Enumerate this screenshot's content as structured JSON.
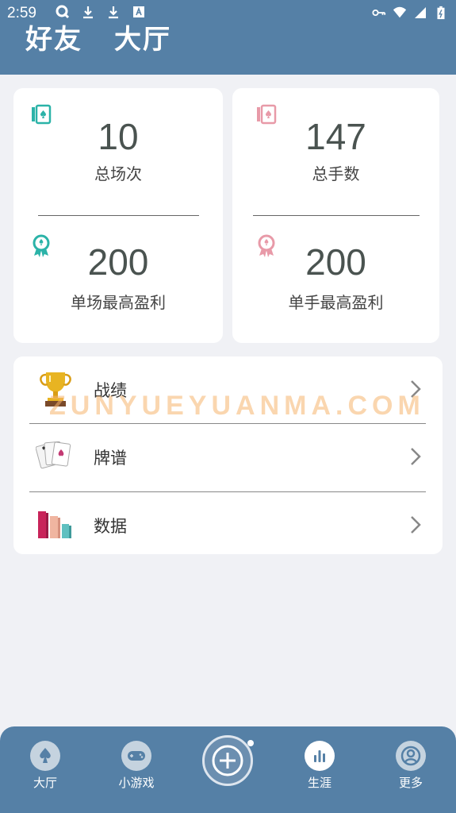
{
  "status_bar": {
    "time": "2:59"
  },
  "header": {
    "tab_friends": "好友",
    "tab_lobby": "大厅"
  },
  "stats": {
    "total_games": {
      "value": "10",
      "label": "总场次"
    },
    "total_hands": {
      "value": "147",
      "label": "总手数"
    },
    "best_game_profit": {
      "value": "200",
      "label": "单场最高盈利"
    },
    "best_hand_profit": {
      "value": "200",
      "label": "单手最高盈利"
    }
  },
  "menu": {
    "items": [
      {
        "label": "战绩",
        "icon": "trophy-icon"
      },
      {
        "label": "牌谱",
        "icon": "cards-icon"
      },
      {
        "label": "数据",
        "icon": "bar-chart-icon"
      }
    ]
  },
  "watermark": "ZUNYUEYUANMA.COM",
  "bottom_nav": {
    "items": [
      {
        "label": "大厅",
        "icon": "spade-icon"
      },
      {
        "label": "小游戏",
        "icon": "gamepad-icon"
      },
      {
        "label": "生涯",
        "icon": "stats-icon"
      },
      {
        "label": "更多",
        "icon": "user-icon"
      }
    ]
  },
  "colors": {
    "header": "#5580a6",
    "teal": "#2bb3a8",
    "pink": "#e89aa8",
    "background": "#f0f1f5"
  }
}
